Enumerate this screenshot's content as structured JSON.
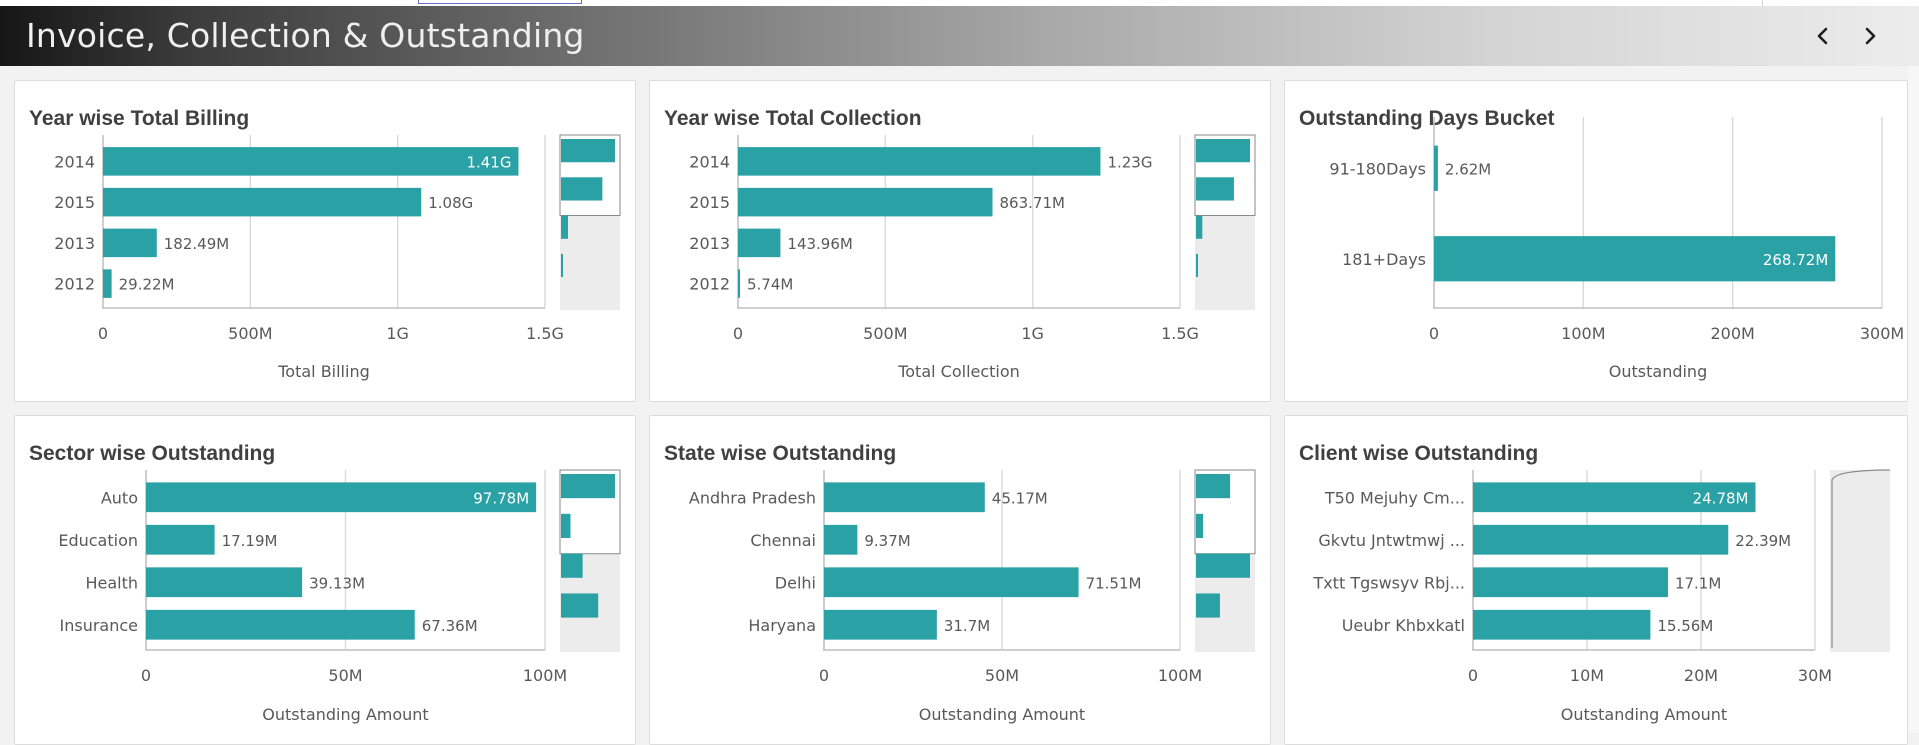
{
  "page": {
    "title": "Invoice, Collection & Outstanding",
    "nav": {
      "prev_icon": "chevron-left-icon",
      "next_icon": "chevron-right-icon"
    },
    "colors": {
      "bar": "#2aa1a5",
      "grid": "#d9d9d9",
      "title": "#404040",
      "label": "#595959"
    }
  },
  "chart_data": [
    {
      "id": "billing",
      "type": "bar",
      "orientation": "horizontal",
      "title": "Year wise Total Billing",
      "categories": [
        "2014",
        "2015",
        "2013",
        "2012"
      ],
      "values": [
        1410000000,
        1080000000,
        182490000,
        29220000
      ],
      "value_labels": [
        "1.41G",
        "1.08G",
        "182.49M",
        "29.22M"
      ],
      "xlabel": "Total Billing",
      "xlim": [
        0,
        1500000000
      ],
      "ticks": [
        0,
        500000000,
        1000000000,
        1500000000
      ],
      "tick_labels": [
        "0",
        "500M",
        "1G",
        "1.5G"
      ],
      "mini_chart": true,
      "grid": true
    },
    {
      "id": "collection",
      "type": "bar",
      "orientation": "horizontal",
      "title": "Year wise Total Collection",
      "categories": [
        "2014",
        "2015",
        "2013",
        "2012"
      ],
      "values": [
        1230000000,
        863710000,
        143960000,
        5740000
      ],
      "value_labels": [
        "1.23G",
        "863.71M",
        "143.96M",
        "5.74M"
      ],
      "xlabel": "Total Collection",
      "xlim": [
        0,
        1500000000
      ],
      "ticks": [
        0,
        500000000,
        1000000000,
        1500000000
      ],
      "tick_labels": [
        "0",
        "500M",
        "1G",
        "1.5G"
      ],
      "mini_chart": true,
      "grid": true
    },
    {
      "id": "bucket",
      "type": "bar",
      "orientation": "horizontal",
      "title": "Outstanding Days Bucket",
      "categories": [
        "91-180Days",
        "181+Days"
      ],
      "values": [
        2620000,
        268720000
      ],
      "value_labels": [
        "2.62M",
        "268.72M"
      ],
      "xlabel": "Outstanding",
      "xlim": [
        0,
        300000000
      ],
      "ticks": [
        0,
        100000000,
        200000000,
        300000000
      ],
      "tick_labels": [
        "0",
        "100M",
        "200M",
        "300M"
      ],
      "mini_chart": false,
      "grid": true
    },
    {
      "id": "sector",
      "type": "bar",
      "orientation": "horizontal",
      "title": "Sector wise Outstanding",
      "categories": [
        "Auto",
        "Education",
        "Health",
        "Insurance"
      ],
      "values": [
        97780000,
        17190000,
        39130000,
        67360000
      ],
      "value_labels": [
        "97.78M",
        "17.19M",
        "39.13M",
        "67.36M"
      ],
      "xlabel": "Outstanding Amount",
      "xlim": [
        0,
        100000000
      ],
      "ticks": [
        0,
        50000000,
        100000000
      ],
      "tick_labels": [
        "0",
        "50M",
        "100M"
      ],
      "mini_chart": true,
      "grid": true
    },
    {
      "id": "state",
      "type": "bar",
      "orientation": "horizontal",
      "title": "State wise Outstanding",
      "categories": [
        "Andhra Pradesh",
        "Chennai",
        "Delhi",
        "Haryana"
      ],
      "values": [
        45170000,
        9370000,
        71510000,
        31700000
      ],
      "value_labels": [
        "45.17M",
        "9.37M",
        "71.51M",
        "31.7M"
      ],
      "xlabel": "Outstanding Amount",
      "xlim": [
        0,
        100000000
      ],
      "ticks": [
        0,
        50000000,
        100000000
      ],
      "tick_labels": [
        "0",
        "50M",
        "100M"
      ],
      "mini_chart": true,
      "grid": true
    },
    {
      "id": "client",
      "type": "bar",
      "orientation": "horizontal",
      "title": "Client wise Outstanding",
      "categories": [
        "T50 Mejuhy Cm...",
        "Gkvtu Jntwtmwj ...",
        "Txtt Tgswsyv Rbj...",
        "Ueubr Khbxkatl"
      ],
      "values": [
        24780000,
        22390000,
        17100000,
        15560000
      ],
      "value_labels": [
        "24.78M",
        "22.39M",
        "17.1M",
        "15.56M"
      ],
      "xlabel": "Outstanding Amount",
      "xlim": [
        0,
        30000000
      ],
      "ticks": [
        0,
        10000000,
        20000000,
        30000000
      ],
      "tick_labels": [
        "0",
        "10M",
        "20M",
        "30M"
      ],
      "mini_chart": true,
      "grid": true
    }
  ]
}
